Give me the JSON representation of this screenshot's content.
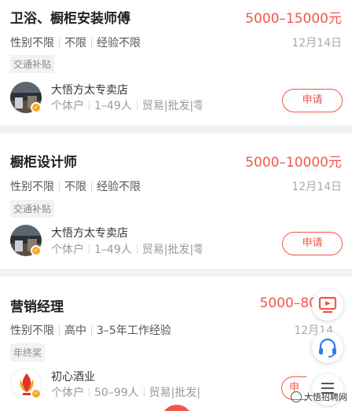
{
  "jobs": [
    {
      "title": "卫浴、橱柜安装师傅",
      "salary": "5000–15000元",
      "requirements": [
        "性别不限",
        "不限",
        "经验不限"
      ],
      "date": "12月14日",
      "tag": "交通补贴",
      "company": "大悟方太专卖店",
      "company_meta": [
        "个体户",
        "1–49人",
        "贸易|批发|零"
      ],
      "apply_label": "申请"
    },
    {
      "title": "橱柜设计师",
      "salary": "5000–10000元",
      "requirements": [
        "性别不限",
        "不限",
        "经验不限"
      ],
      "date": "12月14日",
      "tag": "交通补贴",
      "company": "大悟方太专卖店",
      "company_meta": [
        "个体户",
        "1–49人",
        "贸易|批发|零"
      ],
      "apply_label": "申请"
    },
    {
      "title": "营销经理",
      "salary": "5000–80",
      "requirements": [
        "性别不限",
        "高中",
        "3–5年工作经验"
      ],
      "date": "12月14",
      "tag": "年终奖",
      "company": "初心酒业",
      "company_meta": [
        "个体户",
        "50–99人",
        "贸易|批发|"
      ],
      "apply_label": "申"
    }
  ],
  "watermark": "大悟招聘网",
  "icons": {
    "fab_top": "tv-icon",
    "fab_mid": "headset-icon",
    "fab_bottom": "scroll-top-icon",
    "badge": "verified-icon"
  },
  "colors": {
    "accent": "#f2564a",
    "badge": "#f5a623",
    "fab_blue": "#2f7be8"
  }
}
